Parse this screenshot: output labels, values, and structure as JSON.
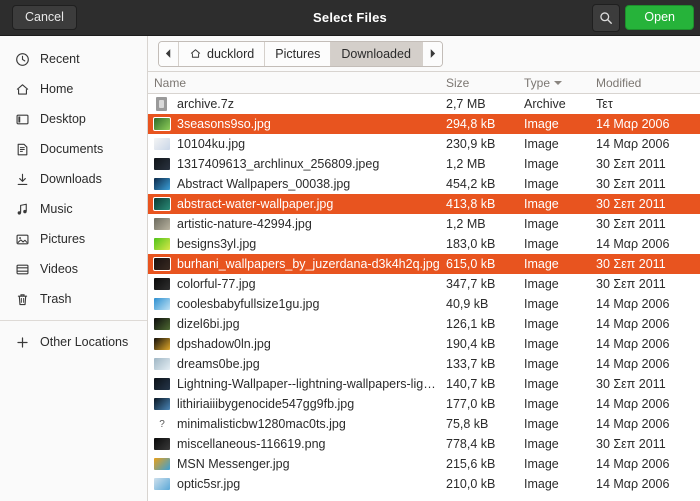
{
  "header": {
    "title": "Select Files",
    "cancel_label": "Cancel",
    "open_label": "Open",
    "search_icon": "search-icon",
    "open_button_color": "#26b33a",
    "bar_color": "#2d2d2d"
  },
  "sidebar": {
    "items": [
      {
        "label": "Recent",
        "icon": "clock-icon"
      },
      {
        "label": "Home",
        "icon": "home-icon"
      },
      {
        "label": "Desktop",
        "icon": "desktop-icon"
      },
      {
        "label": "Documents",
        "icon": "document-icon"
      },
      {
        "label": "Downloads",
        "icon": "download-arrow-icon"
      },
      {
        "label": "Music",
        "icon": "music-note-icon"
      },
      {
        "label": "Pictures",
        "icon": "picture-icon"
      },
      {
        "label": "Videos",
        "icon": "video-icon"
      },
      {
        "label": "Trash",
        "icon": "trash-icon"
      }
    ],
    "other_locations": {
      "label": "Other Locations",
      "icon": "plus-icon"
    }
  },
  "pathbar": {
    "back_icon": "triangle-left-icon",
    "forward_icon": "triangle-right-icon",
    "crumbs": [
      {
        "label": "ducklord",
        "icon": "home-icon",
        "active": false
      },
      {
        "label": "Pictures",
        "icon": "",
        "active": false
      },
      {
        "label": "Downloaded",
        "icon": "",
        "active": true
      }
    ]
  },
  "columns": {
    "name": "Name",
    "size": "Size",
    "type": "Type",
    "modified": "Modified",
    "sorted_by": "Type",
    "sort_icon": "sort-descending-caret-icon"
  },
  "selection_color": "#e8541f",
  "files": [
    {
      "name": "archive.7z",
      "size": "2,7 MB",
      "type": "Archive",
      "modified": "Τετ",
      "selected": false,
      "icon": "archive-icon",
      "c1": "#3a3a3a",
      "c2": "#9b9b9b"
    },
    {
      "name": "3seasons9so.jpg",
      "size": "294,8 kB",
      "type": "Image",
      "modified": "14 Μαρ 2006",
      "selected": true,
      "icon": "thumbnail",
      "c1": "#2f6b2a",
      "c2": "#8fcf5a"
    },
    {
      "name": "10104ku.jpg",
      "size": "230,9 kB",
      "type": "Image",
      "modified": "14 Μαρ 2006",
      "selected": false,
      "icon": "thumbnail",
      "c1": "#f4f4f4",
      "c2": "#c9d6e8"
    },
    {
      "name": "1317409613_archlinux_256809.jpeg",
      "size": "1,2 MB",
      "type": "Image",
      "modified": "30 Σεπ 2011",
      "selected": false,
      "icon": "thumbnail",
      "c1": "#101418",
      "c2": "#2a3340"
    },
    {
      "name": "Abstract Wallpapers_00038.jpg",
      "size": "454,2 kB",
      "type": "Image",
      "modified": "30 Σεπ 2011",
      "selected": false,
      "icon": "thumbnail",
      "c1": "#0d2a4a",
      "c2": "#3b9fd8"
    },
    {
      "name": "abstract-water-wallpaper.jpg",
      "size": "413,8 kB",
      "type": "Image",
      "modified": "30 Σεπ 2011",
      "selected": true,
      "icon": "thumbnail",
      "c1": "#0b3a33",
      "c2": "#2a8c78"
    },
    {
      "name": "artistic-nature-42994.jpg",
      "size": "1,2 MB",
      "type": "Image",
      "modified": "30 Σεπ 2011",
      "selected": false,
      "icon": "thumbnail",
      "c1": "#6b6a5e",
      "c2": "#b9b3a0"
    },
    {
      "name": "besigns3yl.jpg",
      "size": "183,0 kB",
      "type": "Image",
      "modified": "14 Μαρ 2006",
      "selected": false,
      "icon": "thumbnail",
      "c1": "#4fc21a",
      "c2": "#d8e84a"
    },
    {
      "name": "burhani_wallpapers_by_juzerdana-d3k4h2q.jpg",
      "size": "615,0 kB",
      "type": "Image",
      "modified": "30 Σεπ 2011",
      "selected": true,
      "icon": "thumbnail",
      "c1": "#17100e",
      "c2": "#3a2a22"
    },
    {
      "name": "colorful-77.jpg",
      "size": "347,7 kB",
      "type": "Image",
      "modified": "30 Σεπ 2011",
      "selected": false,
      "icon": "thumbnail",
      "c1": "#0a0a0a",
      "c2": "#303030"
    },
    {
      "name": "coolesbabyfullsize1gu.jpg",
      "size": "40,9 kB",
      "type": "Image",
      "modified": "14 Μαρ 2006",
      "selected": false,
      "icon": "thumbnail",
      "c1": "#2d8fd0",
      "c2": "#bfe2f5"
    },
    {
      "name": "dizel6bi.jpg",
      "size": "126,1 kB",
      "type": "Image",
      "modified": "14 Μαρ 2006",
      "selected": false,
      "icon": "thumbnail",
      "c1": "#0c0c0c",
      "c2": "#4f6b33"
    },
    {
      "name": "dpshadow0ln.jpg",
      "size": "190,4 kB",
      "type": "Image",
      "modified": "14 Μαρ 2006",
      "selected": false,
      "icon": "thumbnail",
      "c1": "#120f0a",
      "c2": "#e0a82a"
    },
    {
      "name": "dreams0be.jpg",
      "size": "133,7 kB",
      "type": "Image",
      "modified": "14 Μαρ 2006",
      "selected": false,
      "icon": "thumbnail",
      "c1": "#9fb6c4",
      "c2": "#e4eef4"
    },
    {
      "name": "Lightning-Wallpaper--lightning-wallpapers-lightni...",
      "size": "140,7 kB",
      "type": "Image",
      "modified": "30 Σεπ 2011",
      "selected": false,
      "icon": "thumbnail",
      "c1": "#0b1016",
      "c2": "#25364a"
    },
    {
      "name": "lithiriaiiibygenocide547gg9fb.jpg",
      "size": "177,0 kB",
      "type": "Image",
      "modified": "14 Μαρ 2006",
      "selected": false,
      "icon": "thumbnail",
      "c1": "#0a1622",
      "c2": "#4a86b8"
    },
    {
      "name": "minimalisticbw1280mac0ts.jpg",
      "size": "75,8 kB",
      "type": "Image",
      "modified": "14 Μαρ 2006",
      "selected": false,
      "icon": "unknown-file-icon",
      "c1": "#555555",
      "c2": "#888888"
    },
    {
      "name": "miscellaneous-116619.png",
      "size": "778,4 kB",
      "type": "Image",
      "modified": "30 Σεπ 2011",
      "selected": false,
      "icon": "thumbnail",
      "c1": "#0a0a0a",
      "c2": "#3a3a3a"
    },
    {
      "name": "MSN Messenger.jpg",
      "size": "215,6 kB",
      "type": "Image",
      "modified": "14 Μαρ 2006",
      "selected": false,
      "icon": "thumbnail",
      "c1": "#e8a018",
      "c2": "#3aa0d8"
    },
    {
      "name": "optic5sr.jpg",
      "size": "210,0 kB",
      "type": "Image",
      "modified": "14 Μαρ 2006",
      "selected": false,
      "icon": "thumbnail",
      "c1": "#cfe0ec",
      "c2": "#5aa8d8"
    }
  ]
}
